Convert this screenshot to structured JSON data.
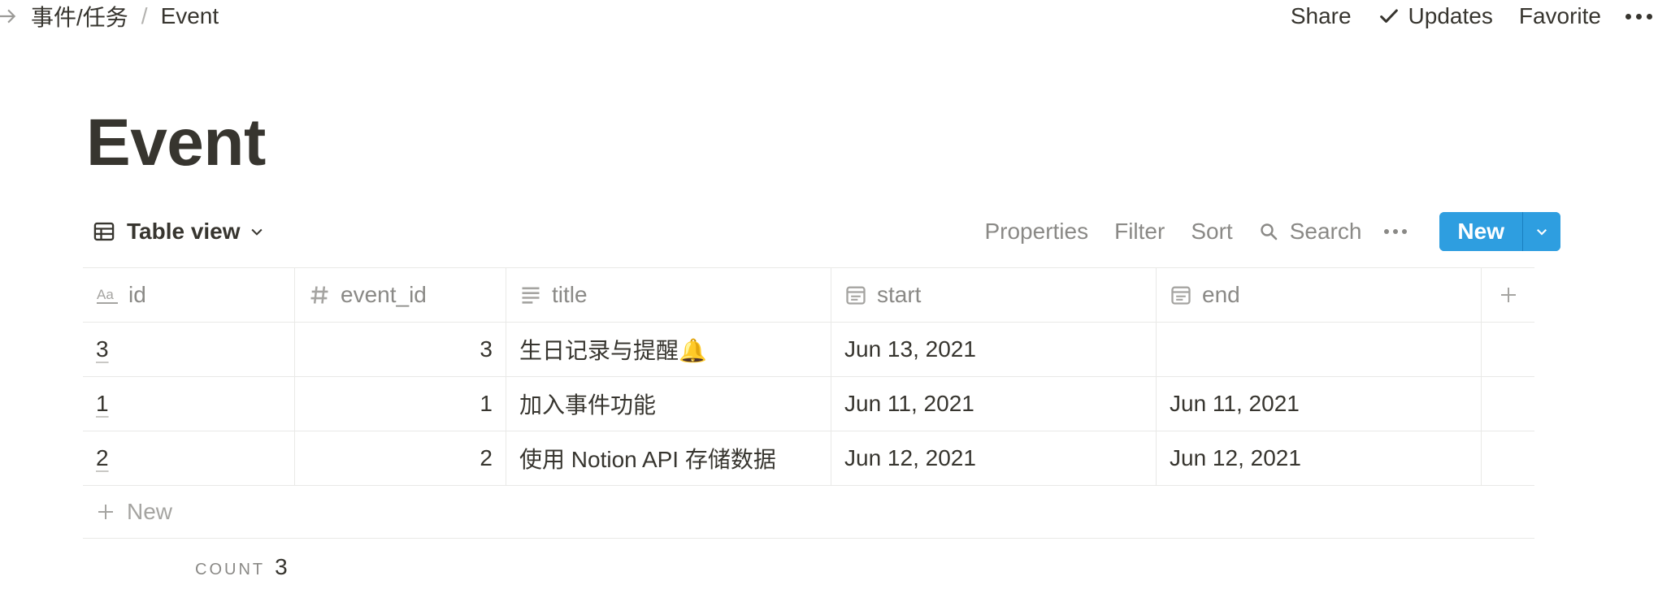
{
  "breadcrumb": {
    "parent": "事件/任务",
    "separator": "/",
    "current": "Event"
  },
  "topbar": {
    "share": "Share",
    "updates": "Updates",
    "favorite": "Favorite"
  },
  "page": {
    "title": "Event"
  },
  "view": {
    "name": "Table view",
    "tools": {
      "properties": "Properties",
      "filter": "Filter",
      "sort": "Sort",
      "search": "Search"
    },
    "new_button": "New"
  },
  "table": {
    "columns": [
      {
        "name": "id",
        "icon": "text-aa-icon"
      },
      {
        "name": "event_id",
        "icon": "number-hash-icon"
      },
      {
        "name": "title",
        "icon": "text-lines-icon"
      },
      {
        "name": "start",
        "icon": "calendar-icon"
      },
      {
        "name": "end",
        "icon": "calendar-icon"
      }
    ],
    "rows": [
      {
        "id": "3",
        "event_id": "3",
        "title": "生日记录与提醒🔔",
        "start": "Jun 13, 2021",
        "end": ""
      },
      {
        "id": "1",
        "event_id": "1",
        "title": "加入事件功能",
        "start": "Jun 11, 2021",
        "end": "Jun 11, 2021"
      },
      {
        "id": "2",
        "event_id": "2",
        "title": "使用 Notion API 存储数据",
        "start": "Jun 12, 2021",
        "end": "Jun 12, 2021"
      }
    ],
    "new_row_label": "New",
    "count_label": "COUNT",
    "count_value": "3"
  },
  "colors": {
    "accent": "#2e9ee0",
    "text": "#37352f",
    "muted": "#8a8986",
    "border": "#e9e9e7"
  }
}
